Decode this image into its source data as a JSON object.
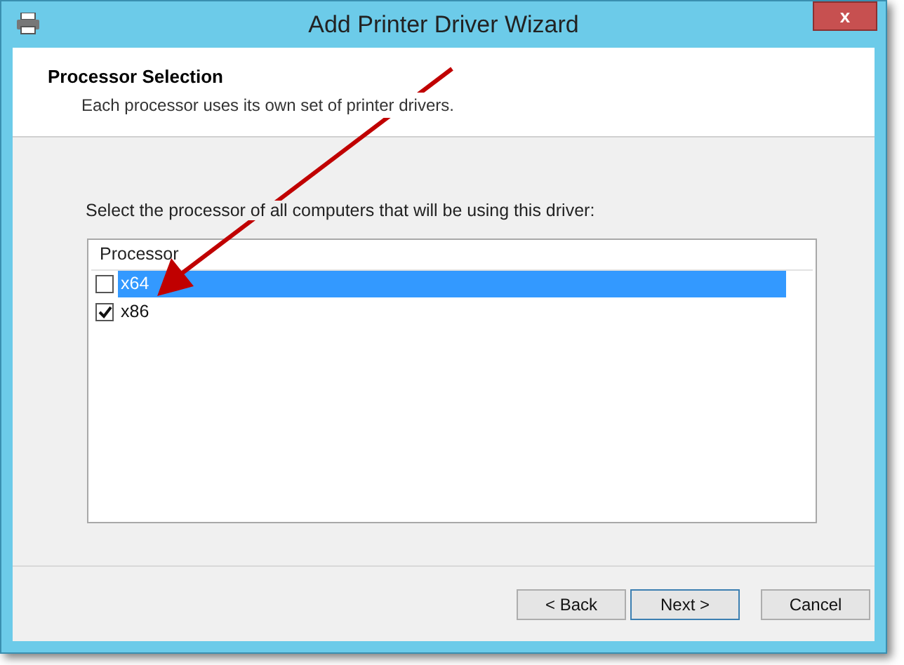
{
  "window": {
    "title": "Add Printer Driver Wizard",
    "close": "x"
  },
  "header": {
    "title": "Processor Selection",
    "subtitle": "Each processor uses its own set of printer drivers."
  },
  "instruction": "Select the processor of all computers that will be using this driver:",
  "list": {
    "column": "Processor",
    "rows": [
      {
        "label": "x64",
        "checked": false,
        "selected": true
      },
      {
        "label": "x86",
        "checked": true,
        "selected": false
      }
    ]
  },
  "buttons": [
    {
      "label": "< Back",
      "kind": "normal"
    },
    {
      "label": "Next >",
      "kind": "default"
    },
    {
      "label": "Cancel",
      "kind": "cancel"
    }
  ]
}
